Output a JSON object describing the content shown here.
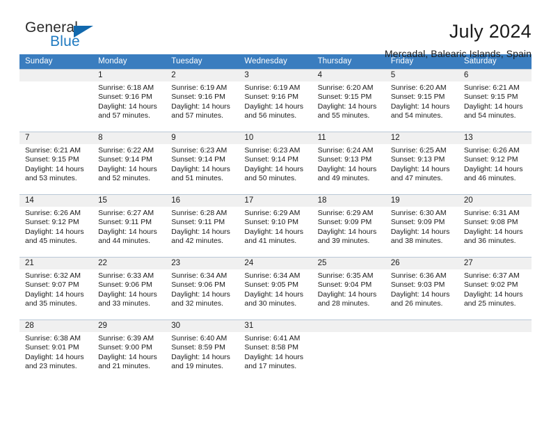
{
  "brand": {
    "name_top": "General",
    "name_bottom": "Blue",
    "triangle_color": "#1168ad",
    "blue_color": "#1f7ac0"
  },
  "header": {
    "title": "July 2024",
    "subtitle": "Mercadal, Balearic Islands, Spain"
  },
  "calendar": {
    "header_bg": "#3a7dbf",
    "daynum_bg": "#f0f0f0",
    "weekdays": [
      "Sunday",
      "Monday",
      "Tuesday",
      "Wednesday",
      "Thursday",
      "Friday",
      "Saturday"
    ],
    "weeks": [
      {
        "days": [
          {
            "num": "",
            "sunrise": "",
            "sunset": "",
            "daylight1": "",
            "daylight2": "",
            "empty": true
          },
          {
            "num": "1",
            "sunrise": "Sunrise: 6:18 AM",
            "sunset": "Sunset: 9:16 PM",
            "daylight1": "Daylight: 14 hours",
            "daylight2": "and 57 minutes.",
            "empty": false
          },
          {
            "num": "2",
            "sunrise": "Sunrise: 6:19 AM",
            "sunset": "Sunset: 9:16 PM",
            "daylight1": "Daylight: 14 hours",
            "daylight2": "and 57 minutes.",
            "empty": false
          },
          {
            "num": "3",
            "sunrise": "Sunrise: 6:19 AM",
            "sunset": "Sunset: 9:16 PM",
            "daylight1": "Daylight: 14 hours",
            "daylight2": "and 56 minutes.",
            "empty": false
          },
          {
            "num": "4",
            "sunrise": "Sunrise: 6:20 AM",
            "sunset": "Sunset: 9:15 PM",
            "daylight1": "Daylight: 14 hours",
            "daylight2": "and 55 minutes.",
            "empty": false
          },
          {
            "num": "5",
            "sunrise": "Sunrise: 6:20 AM",
            "sunset": "Sunset: 9:15 PM",
            "daylight1": "Daylight: 14 hours",
            "daylight2": "and 54 minutes.",
            "empty": false
          },
          {
            "num": "6",
            "sunrise": "Sunrise: 6:21 AM",
            "sunset": "Sunset: 9:15 PM",
            "daylight1": "Daylight: 14 hours",
            "daylight2": "and 54 minutes.",
            "empty": false
          }
        ]
      },
      {
        "days": [
          {
            "num": "7",
            "sunrise": "Sunrise: 6:21 AM",
            "sunset": "Sunset: 9:15 PM",
            "daylight1": "Daylight: 14 hours",
            "daylight2": "and 53 minutes.",
            "empty": false
          },
          {
            "num": "8",
            "sunrise": "Sunrise: 6:22 AM",
            "sunset": "Sunset: 9:14 PM",
            "daylight1": "Daylight: 14 hours",
            "daylight2": "and 52 minutes.",
            "empty": false
          },
          {
            "num": "9",
            "sunrise": "Sunrise: 6:23 AM",
            "sunset": "Sunset: 9:14 PM",
            "daylight1": "Daylight: 14 hours",
            "daylight2": "and 51 minutes.",
            "empty": false
          },
          {
            "num": "10",
            "sunrise": "Sunrise: 6:23 AM",
            "sunset": "Sunset: 9:14 PM",
            "daylight1": "Daylight: 14 hours",
            "daylight2": "and 50 minutes.",
            "empty": false
          },
          {
            "num": "11",
            "sunrise": "Sunrise: 6:24 AM",
            "sunset": "Sunset: 9:13 PM",
            "daylight1": "Daylight: 14 hours",
            "daylight2": "and 49 minutes.",
            "empty": false
          },
          {
            "num": "12",
            "sunrise": "Sunrise: 6:25 AM",
            "sunset": "Sunset: 9:13 PM",
            "daylight1": "Daylight: 14 hours",
            "daylight2": "and 47 minutes.",
            "empty": false
          },
          {
            "num": "13",
            "sunrise": "Sunrise: 6:26 AM",
            "sunset": "Sunset: 9:12 PM",
            "daylight1": "Daylight: 14 hours",
            "daylight2": "and 46 minutes.",
            "empty": false
          }
        ]
      },
      {
        "days": [
          {
            "num": "14",
            "sunrise": "Sunrise: 6:26 AM",
            "sunset": "Sunset: 9:12 PM",
            "daylight1": "Daylight: 14 hours",
            "daylight2": "and 45 minutes.",
            "empty": false
          },
          {
            "num": "15",
            "sunrise": "Sunrise: 6:27 AM",
            "sunset": "Sunset: 9:11 PM",
            "daylight1": "Daylight: 14 hours",
            "daylight2": "and 44 minutes.",
            "empty": false
          },
          {
            "num": "16",
            "sunrise": "Sunrise: 6:28 AM",
            "sunset": "Sunset: 9:11 PM",
            "daylight1": "Daylight: 14 hours",
            "daylight2": "and 42 minutes.",
            "empty": false
          },
          {
            "num": "17",
            "sunrise": "Sunrise: 6:29 AM",
            "sunset": "Sunset: 9:10 PM",
            "daylight1": "Daylight: 14 hours",
            "daylight2": "and 41 minutes.",
            "empty": false
          },
          {
            "num": "18",
            "sunrise": "Sunrise: 6:29 AM",
            "sunset": "Sunset: 9:09 PM",
            "daylight1": "Daylight: 14 hours",
            "daylight2": "and 39 minutes.",
            "empty": false
          },
          {
            "num": "19",
            "sunrise": "Sunrise: 6:30 AM",
            "sunset": "Sunset: 9:09 PM",
            "daylight1": "Daylight: 14 hours",
            "daylight2": "and 38 minutes.",
            "empty": false
          },
          {
            "num": "20",
            "sunrise": "Sunrise: 6:31 AM",
            "sunset": "Sunset: 9:08 PM",
            "daylight1": "Daylight: 14 hours",
            "daylight2": "and 36 minutes.",
            "empty": false
          }
        ]
      },
      {
        "days": [
          {
            "num": "21",
            "sunrise": "Sunrise: 6:32 AM",
            "sunset": "Sunset: 9:07 PM",
            "daylight1": "Daylight: 14 hours",
            "daylight2": "and 35 minutes.",
            "empty": false
          },
          {
            "num": "22",
            "sunrise": "Sunrise: 6:33 AM",
            "sunset": "Sunset: 9:06 PM",
            "daylight1": "Daylight: 14 hours",
            "daylight2": "and 33 minutes.",
            "empty": false
          },
          {
            "num": "23",
            "sunrise": "Sunrise: 6:34 AM",
            "sunset": "Sunset: 9:06 PM",
            "daylight1": "Daylight: 14 hours",
            "daylight2": "and 32 minutes.",
            "empty": false
          },
          {
            "num": "24",
            "sunrise": "Sunrise: 6:34 AM",
            "sunset": "Sunset: 9:05 PM",
            "daylight1": "Daylight: 14 hours",
            "daylight2": "and 30 minutes.",
            "empty": false
          },
          {
            "num": "25",
            "sunrise": "Sunrise: 6:35 AM",
            "sunset": "Sunset: 9:04 PM",
            "daylight1": "Daylight: 14 hours",
            "daylight2": "and 28 minutes.",
            "empty": false
          },
          {
            "num": "26",
            "sunrise": "Sunrise: 6:36 AM",
            "sunset": "Sunset: 9:03 PM",
            "daylight1": "Daylight: 14 hours",
            "daylight2": "and 26 minutes.",
            "empty": false
          },
          {
            "num": "27",
            "sunrise": "Sunrise: 6:37 AM",
            "sunset": "Sunset: 9:02 PM",
            "daylight1": "Daylight: 14 hours",
            "daylight2": "and 25 minutes.",
            "empty": false
          }
        ]
      },
      {
        "days": [
          {
            "num": "28",
            "sunrise": "Sunrise: 6:38 AM",
            "sunset": "Sunset: 9:01 PM",
            "daylight1": "Daylight: 14 hours",
            "daylight2": "and 23 minutes.",
            "empty": false
          },
          {
            "num": "29",
            "sunrise": "Sunrise: 6:39 AM",
            "sunset": "Sunset: 9:00 PM",
            "daylight1": "Daylight: 14 hours",
            "daylight2": "and 21 minutes.",
            "empty": false
          },
          {
            "num": "30",
            "sunrise": "Sunrise: 6:40 AM",
            "sunset": "Sunset: 8:59 PM",
            "daylight1": "Daylight: 14 hours",
            "daylight2": "and 19 minutes.",
            "empty": false
          },
          {
            "num": "31",
            "sunrise": "Sunrise: 6:41 AM",
            "sunset": "Sunset: 8:58 PM",
            "daylight1": "Daylight: 14 hours",
            "daylight2": "and 17 minutes.",
            "empty": false
          },
          {
            "num": "",
            "sunrise": "",
            "sunset": "",
            "daylight1": "",
            "daylight2": "",
            "empty": true
          },
          {
            "num": "",
            "sunrise": "",
            "sunset": "",
            "daylight1": "",
            "daylight2": "",
            "empty": true
          },
          {
            "num": "",
            "sunrise": "",
            "sunset": "",
            "daylight1": "",
            "daylight2": "",
            "empty": true
          }
        ]
      }
    ]
  }
}
